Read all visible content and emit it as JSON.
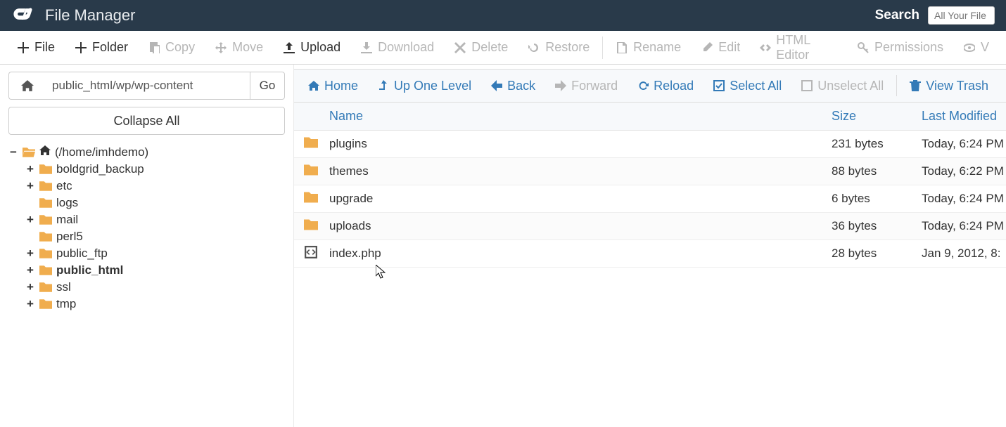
{
  "header": {
    "title": "File Manager",
    "search_label": "Search",
    "search_placeholder": "All Your File"
  },
  "toolbar": [
    {
      "icon": "plus",
      "label": "File",
      "disabled": false
    },
    {
      "icon": "plus",
      "label": "Folder",
      "disabled": false
    },
    {
      "icon": "copy",
      "label": "Copy",
      "disabled": true
    },
    {
      "icon": "move",
      "label": "Move",
      "disabled": true
    },
    {
      "icon": "upload",
      "label": "Upload",
      "disabled": false
    },
    {
      "icon": "download",
      "label": "Download",
      "disabled": true
    },
    {
      "icon": "times",
      "label": "Delete",
      "disabled": true
    },
    {
      "icon": "restore",
      "label": "Restore",
      "disabled": true
    },
    {
      "type": "sep"
    },
    {
      "icon": "file",
      "label": "Rename",
      "disabled": true
    },
    {
      "icon": "pencil",
      "label": "Edit",
      "disabled": true
    },
    {
      "icon": "code",
      "label": "HTML Editor",
      "disabled": true
    },
    {
      "icon": "key",
      "label": "Permissions",
      "disabled": true
    },
    {
      "icon": "eye",
      "label": "V",
      "disabled": true
    }
  ],
  "path": {
    "value": "public_html/wp/wp-content",
    "go": "Go",
    "collapse": "Collapse All"
  },
  "tree": {
    "root": {
      "label": "(/home/imhdemo)",
      "expanded": true
    },
    "children": [
      {
        "label": "boldgrid_backup",
        "hasChildren": true
      },
      {
        "label": "etc",
        "hasChildren": true
      },
      {
        "label": "logs",
        "hasChildren": false
      },
      {
        "label": "mail",
        "hasChildren": true
      },
      {
        "label": "perl5",
        "hasChildren": false
      },
      {
        "label": "public_ftp",
        "hasChildren": true
      },
      {
        "label": "public_html",
        "hasChildren": true,
        "bold": true
      },
      {
        "label": "ssl",
        "hasChildren": true
      },
      {
        "label": "tmp",
        "hasChildren": true
      }
    ]
  },
  "navbar": [
    {
      "icon": "home",
      "label": "Home",
      "disabled": false
    },
    {
      "icon": "levelup",
      "label": "Up One Level",
      "disabled": false
    },
    {
      "icon": "back",
      "label": "Back",
      "disabled": false
    },
    {
      "icon": "forward",
      "label": "Forward",
      "disabled": true
    },
    {
      "icon": "reload",
      "label": "Reload",
      "disabled": false
    },
    {
      "icon": "checkbox",
      "label": "Select All",
      "disabled": false
    },
    {
      "icon": "unchecked",
      "label": "Unselect All",
      "disabled": true
    },
    {
      "type": "sep"
    },
    {
      "icon": "trash",
      "label": "View Trash",
      "disabled": false
    }
  ],
  "columns": {
    "name": "Name",
    "size": "Size",
    "modified": "Last Modified"
  },
  "files": [
    {
      "type": "folder",
      "name": "plugins",
      "size": "231 bytes",
      "modified": "Today, 6:24 PM"
    },
    {
      "type": "folder",
      "name": "themes",
      "size": "88 bytes",
      "modified": "Today, 6:22 PM"
    },
    {
      "type": "folder",
      "name": "upgrade",
      "size": "6 bytes",
      "modified": "Today, 6:24 PM"
    },
    {
      "type": "folder",
      "name": "uploads",
      "size": "36 bytes",
      "modified": "Today, 6:24 PM"
    },
    {
      "type": "file",
      "name": "index.php",
      "size": "28 bytes",
      "modified": "Jan 9, 2012, 8:"
    }
  ]
}
